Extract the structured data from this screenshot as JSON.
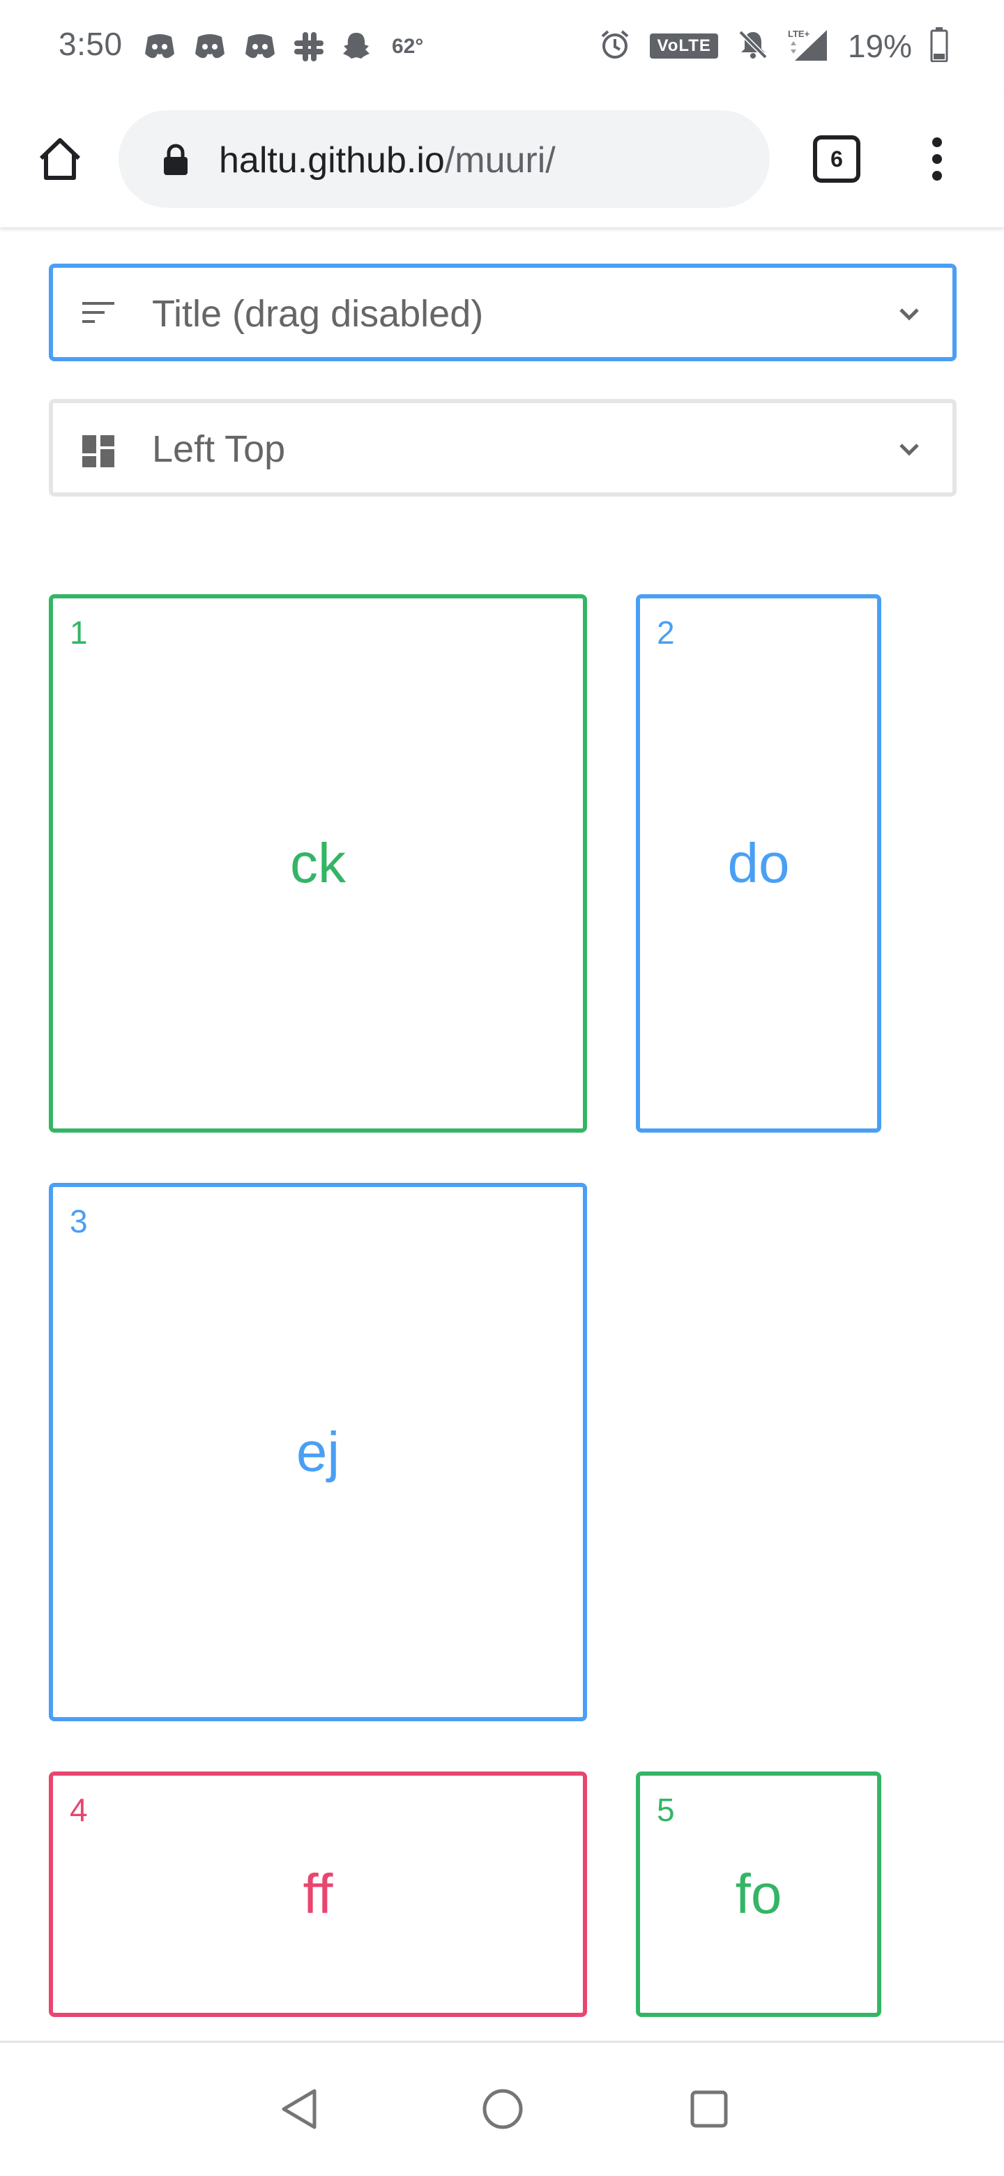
{
  "status_bar": {
    "time": "3:50",
    "temperature": "62°",
    "volte": "VoLTE",
    "battery": "19%",
    "icons_left": [
      "discord-icon",
      "discord-icon",
      "discord-icon",
      "slack-icon",
      "snapchat-icon"
    ],
    "icons_right": [
      "alarm-icon",
      "volte-badge",
      "muted-bell-icon",
      "lte-signal-icon",
      "battery-icon"
    ]
  },
  "browser": {
    "url_host": "haltu.github.io",
    "url_path": "/muuri/",
    "tab_count": "6"
  },
  "controls": {
    "sort_select": {
      "label": "Title (drag disabled)",
      "icon": "sort-icon"
    },
    "layout_select": {
      "label": "Left Top",
      "icon": "dashboard-icon"
    }
  },
  "grid_items": [
    {
      "number": "1",
      "title": "ck",
      "color": "#34b565"
    },
    {
      "number": "2",
      "title": "do",
      "color": "#4a9ff5"
    },
    {
      "number": "3",
      "title": "ej",
      "color": "#4a9ff5"
    },
    {
      "number": "4",
      "title": "ff",
      "color": "#e8466f"
    },
    {
      "number": "5",
      "title": "fo",
      "color": "#34b565"
    }
  ],
  "colors": {
    "green": "#34b565",
    "blue": "#4a9ff5",
    "red": "#e8466f",
    "focus_border": "#4a9ff5"
  }
}
